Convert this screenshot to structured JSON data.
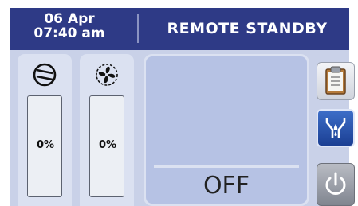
{
  "header": {
    "date": "06 Apr",
    "time": "07:40 am",
    "status": "REMOTE STANDBY"
  },
  "compressor": {
    "icon": "compressor-icon",
    "value": "0%"
  },
  "fan": {
    "icon": "fan-icon",
    "value": "0%"
  },
  "mode": {
    "label": "OFF"
  },
  "side_buttons": [
    {
      "icon": "clipboard-icon"
    },
    {
      "icon": "valve-icon",
      "active": true
    },
    {
      "icon": "power-icon"
    }
  ],
  "colors": {
    "header_bg": "#2e3a86",
    "panel_bg": "#c9d1e8",
    "active_button": "#2a56b0"
  }
}
